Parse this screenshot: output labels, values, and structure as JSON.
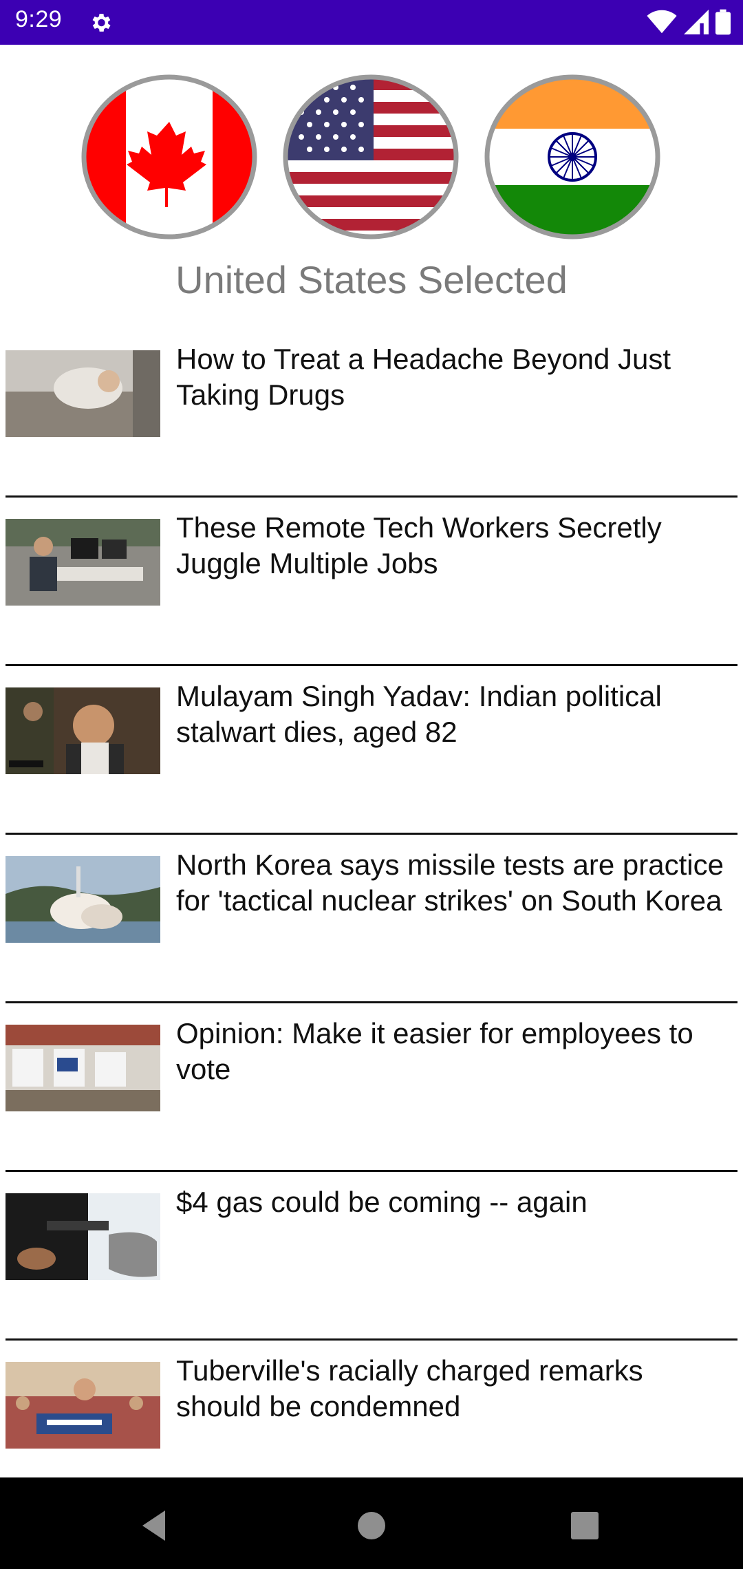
{
  "status_bar": {
    "time": "9:29",
    "background": "#3c00b3",
    "icons": [
      "gear-icon",
      "wifi-icon",
      "cell-signal-icon",
      "battery-icon"
    ]
  },
  "countries": [
    {
      "name": "Canada",
      "flag_icon": "canada-flag-icon"
    },
    {
      "name": "United States",
      "flag_icon": "usa-flag-icon",
      "selected": true
    },
    {
      "name": "India",
      "flag_icon": "india-flag-icon"
    }
  ],
  "selected_label": "United States Selected",
  "news": [
    {
      "title": "How to Treat a Headache Beyond Just Taking Drugs"
    },
    {
      "title": "These Remote Tech Workers Secretly Juggle Multiple Jobs"
    },
    {
      "title": "Mulayam Singh Yadav: Indian political stalwart dies, aged 82"
    },
    {
      "title": "North Korea says missile tests are practice for 'tactical nuclear strikes' on South Korea"
    },
    {
      "title": "Opinion: Make it easier for employees to vote"
    },
    {
      "title": "$4 gas could be coming -- again"
    },
    {
      "title": "Tuberville's racially charged remarks should be condemned"
    }
  ],
  "nav_bar": {
    "buttons": [
      "back-icon",
      "home-icon",
      "recents-icon"
    ]
  }
}
